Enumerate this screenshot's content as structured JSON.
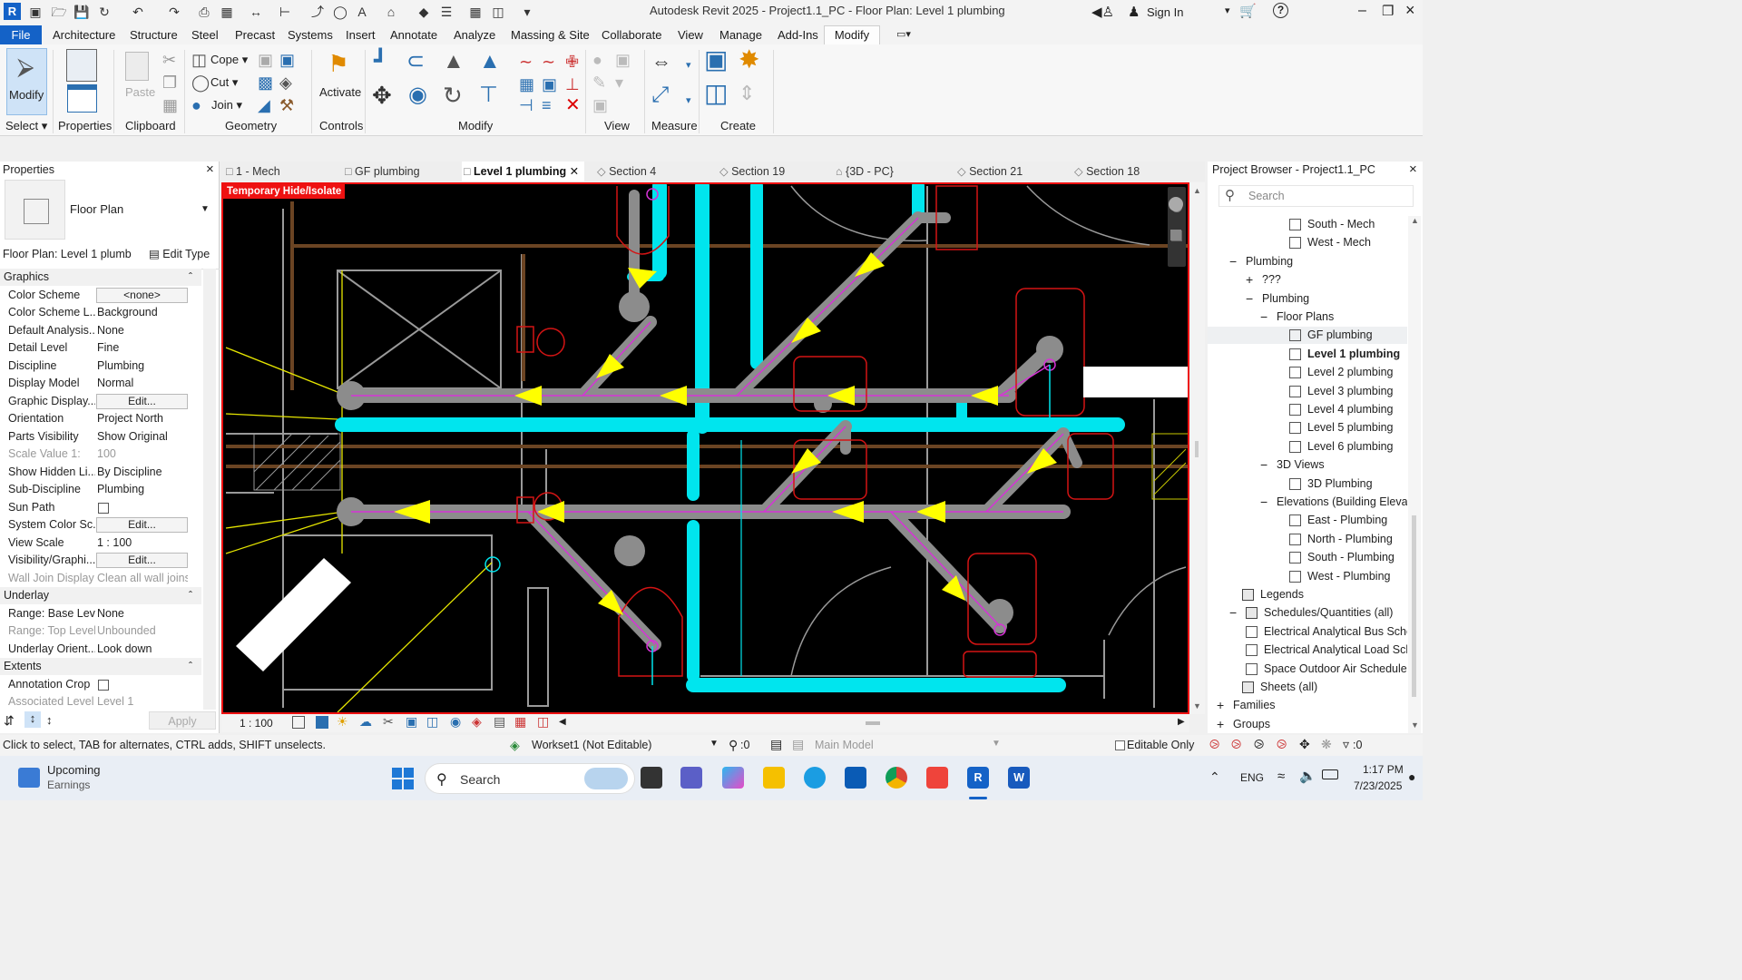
{
  "app": {
    "title": "Autodesk Revit 2025 - Project1.1_PC - Floor Plan: Level 1 plumbing",
    "sign_in": "Sign In",
    "logo": "R"
  },
  "menu": {
    "tabs": [
      "File",
      "Architecture",
      "Structure",
      "Steel",
      "Precast",
      "Systems",
      "Insert",
      "Annotate",
      "Analyze",
      "Massing & Site",
      "Collaborate",
      "View",
      "Manage",
      "Add-Ins",
      "Modify"
    ],
    "active_tab": "Modify"
  },
  "ribbon": {
    "modify_label": "Modify",
    "paste_label": "Paste",
    "cope_label": "Cope",
    "cut_label": "Cut",
    "join_label": "Join",
    "activate_label": "Activate",
    "panels": {
      "select": "Select",
      "properties": "Properties",
      "clipboard": "Clipboard",
      "geometry": "Geometry",
      "controls": "Controls",
      "modify": "Modify",
      "view": "View",
      "measure": "Measure",
      "create": "Create"
    }
  },
  "properties": {
    "title": "Properties",
    "type_name": "Floor Plan",
    "selector": "Floor Plan: Level 1 plumb",
    "edit_type": "Edit Type",
    "sections": {
      "graphics": "Graphics",
      "underlay": "Underlay",
      "extents": "Extents"
    },
    "graphics_rows": [
      {
        "key": "Color Scheme",
        "value": "<none>",
        "button": true
      },
      {
        "key": "Color Scheme L...",
        "value": "Background"
      },
      {
        "key": "Default Analysis...",
        "value": "None"
      },
      {
        "key": "Detail Level",
        "value": "Fine"
      },
      {
        "key": "Discipline",
        "value": "Plumbing"
      },
      {
        "key": "Display Model",
        "value": "Normal"
      },
      {
        "key": "Graphic Display...",
        "value": "Edit...",
        "button": true
      },
      {
        "key": "Orientation",
        "value": "Project North"
      },
      {
        "key": "Parts Visibility",
        "value": "Show Original"
      },
      {
        "key": "Scale Value    1:",
        "value": "100",
        "grey": true
      },
      {
        "key": "Show Hidden Li...",
        "value": "By Discipline"
      },
      {
        "key": "Sub-Discipline",
        "value": "Plumbing"
      },
      {
        "key": "Sun Path",
        "value": "",
        "checkbox": true
      },
      {
        "key": "System Color Sc...",
        "value": "Edit...",
        "button": true
      },
      {
        "key": "View Scale",
        "value": "1 : 100"
      },
      {
        "key": "Visibility/Graphi...",
        "value": "Edit...",
        "button": true
      },
      {
        "key": "Wall Join Display",
        "value": "Clean all wall joins",
        "grey": true
      }
    ],
    "underlay_rows": [
      {
        "key": "Range: Base Lev...",
        "value": "None"
      },
      {
        "key": "Range: Top Level",
        "value": "Unbounded",
        "grey": true
      },
      {
        "key": "Underlay Orient...",
        "value": "Look down"
      }
    ],
    "extents_rows": [
      {
        "key": "Annotation Crop",
        "value": "",
        "checkbox": true
      },
      {
        "key": "Associated Level",
        "value": "Level 1",
        "grey": true
      }
    ],
    "apply": "Apply"
  },
  "view_tabs": [
    {
      "label": "1 - Mech",
      "icon": "plan-view-icon"
    },
    {
      "label": "GF plumbing",
      "icon": "plan-view-icon"
    },
    {
      "label": "Level 1 plumbing",
      "icon": "plan-view-icon",
      "active": true
    },
    {
      "label": "Section 4",
      "icon": "section-view-icon"
    },
    {
      "label": "Section 19",
      "icon": "section-view-icon"
    },
    {
      "label": "{3D - PC}",
      "icon": "3d-view-icon"
    },
    {
      "label": "Section 21",
      "icon": "section-view-icon"
    },
    {
      "label": "Section 18",
      "icon": "section-view-icon"
    }
  ],
  "canvas": {
    "temp_banner": "Temporary Hide/Isolate",
    "scale": "1 : 100"
  },
  "browser": {
    "title": "Project Browser - Project1.1_PC",
    "search_placeholder": "Search",
    "items": [
      {
        "label": "South - Mech",
        "level": 4,
        "icon": "view"
      },
      {
        "label": "West - Mech",
        "level": 4,
        "icon": "view"
      },
      {
        "label": "Plumbing",
        "level": 1,
        "toggle": "-"
      },
      {
        "label": "???",
        "level": 2,
        "toggle": "+"
      },
      {
        "label": "Plumbing",
        "level": 2,
        "toggle": "-"
      },
      {
        "label": "Floor Plans",
        "level": 3,
        "toggle": "-"
      },
      {
        "label": "GF plumbing",
        "level": 4,
        "icon": "view",
        "highlight": true
      },
      {
        "label": "Level 1 plumbing",
        "level": 4,
        "icon": "view",
        "bold": true
      },
      {
        "label": "Level 2 plumbing",
        "level": 4,
        "icon": "view"
      },
      {
        "label": "Level 3 plumbing",
        "level": 4,
        "icon": "view"
      },
      {
        "label": "Level 4 plumbing",
        "level": 4,
        "icon": "view"
      },
      {
        "label": "Level 5 plumbing",
        "level": 4,
        "icon": "view"
      },
      {
        "label": "Level 6 plumbing",
        "level": 4,
        "icon": "view"
      },
      {
        "label": "3D Views",
        "level": 3,
        "toggle": "-"
      },
      {
        "label": "3D Plumbing",
        "level": 4,
        "icon": "view"
      },
      {
        "label": "Elevations (Building Elevati",
        "level": 3,
        "toggle": "-"
      },
      {
        "label": "East - Plumbing",
        "level": 4,
        "icon": "view"
      },
      {
        "label": "North - Plumbing",
        "level": 4,
        "icon": "view"
      },
      {
        "label": "South - Plumbing",
        "level": 4,
        "icon": "view"
      },
      {
        "label": "West - Plumbing",
        "level": 4,
        "icon": "view"
      },
      {
        "label": "Legends",
        "level": 1,
        "icon": "legend"
      },
      {
        "label": "Schedules/Quantities (all)",
        "level": 1,
        "icon": "schedule",
        "toggle": "-"
      },
      {
        "label": "Electrical Analytical Bus Sche",
        "level": 2,
        "icon": "view"
      },
      {
        "label": "Electrical Analytical Load Sch",
        "level": 2,
        "icon": "view"
      },
      {
        "label": "Space Outdoor Air Schedule",
        "level": 2,
        "icon": "view"
      },
      {
        "label": "Sheets (all)",
        "level": 1,
        "icon": "sheet"
      },
      {
        "label": "Families",
        "level": 0,
        "toggle": "+"
      },
      {
        "label": "Groups",
        "level": 0,
        "toggle": "+"
      }
    ]
  },
  "status": {
    "hint": "Click to select, TAB for alternates, CTRL adds, SHIFT unselects.",
    "workset": "Workset1 (Not Editable)",
    "count": ":0",
    "model": "Main Model",
    "editable_only": "Editable Only",
    "filter": ":0"
  },
  "taskbar": {
    "widget_title": "Upcoming",
    "widget_sub": "Earnings",
    "search": "Search",
    "lang": "ENG",
    "time": "1:17 PM",
    "date": "7/23/2025"
  },
  "colors": {
    "accent": "#0a5bb5",
    "pipe_cyan": "#00e5ee",
    "pipe_gray": "#8c8c8c",
    "flow_arrow": "#ffff00",
    "fixture_red": "#d41414",
    "crop_red": "#ee1111"
  }
}
